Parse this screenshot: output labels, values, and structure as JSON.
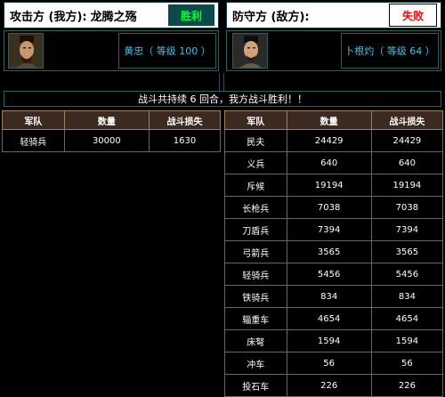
{
  "attacker": {
    "label": "攻击方 (我方):",
    "name": "龙腾之殇",
    "status": "胜利",
    "general": "黄忠",
    "level_text": "（ 等级 100 ）"
  },
  "defender": {
    "label": "防守方 (敌方):",
    "status": "失败",
    "general": "卜根灼",
    "level_text": "（ 等级 64 ）"
  },
  "summary": "战斗共持续 6 回合，我方战斗胜利！！",
  "columns": [
    "军队",
    "数量",
    "战斗损失"
  ],
  "attacker_troops": [
    {
      "unit": "轻骑兵",
      "count": "30000",
      "loss": "1630"
    }
  ],
  "defender_troops": [
    {
      "unit": "民夫",
      "count": "24429",
      "loss": "24429"
    },
    {
      "unit": "义兵",
      "count": "640",
      "loss": "640"
    },
    {
      "unit": "斥候",
      "count": "19194",
      "loss": "19194"
    },
    {
      "unit": "长枪兵",
      "count": "7038",
      "loss": "7038"
    },
    {
      "unit": "刀盾兵",
      "count": "7394",
      "loss": "7394"
    },
    {
      "unit": "弓箭兵",
      "count": "3565",
      "loss": "3565"
    },
    {
      "unit": "轻骑兵",
      "count": "5456",
      "loss": "5456"
    },
    {
      "unit": "铁骑兵",
      "count": "834",
      "loss": "834"
    },
    {
      "unit": "辎重车",
      "count": "4654",
      "loss": "4654"
    },
    {
      "unit": "床弩",
      "count": "1594",
      "loss": "1594"
    },
    {
      "unit": "冲车",
      "count": "56",
      "loss": "56"
    },
    {
      "unit": "投石车",
      "count": "226",
      "loss": "226"
    }
  ]
}
